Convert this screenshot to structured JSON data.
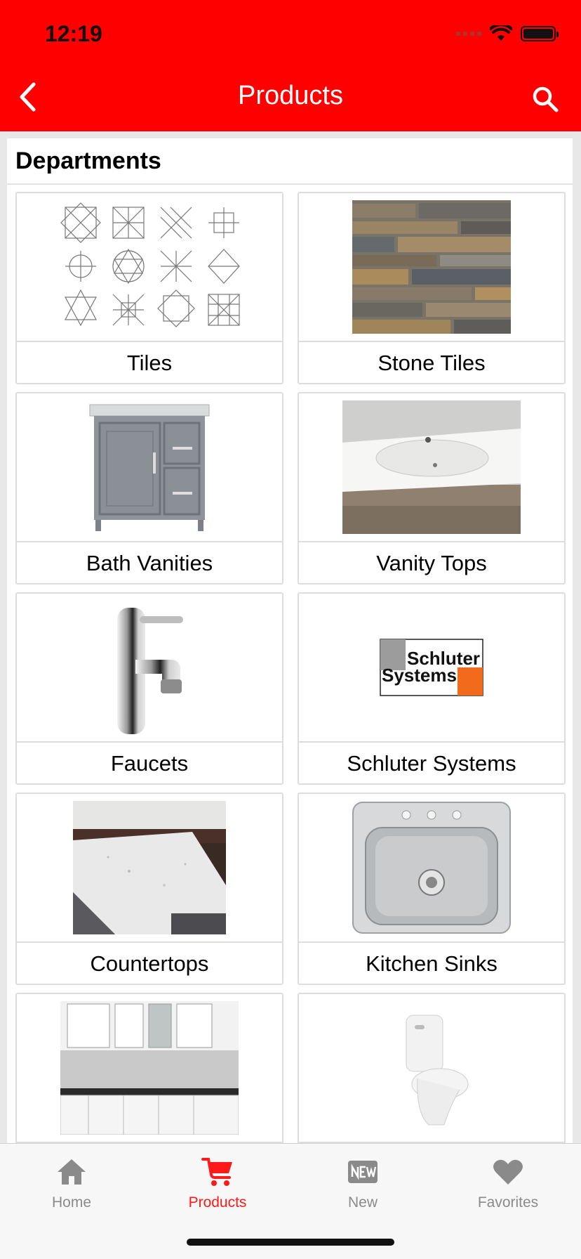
{
  "status": {
    "time": "12:19"
  },
  "nav": {
    "title": "Products"
  },
  "section": {
    "title": "Departments"
  },
  "departments": [
    {
      "label": "Tiles",
      "image": "tile-patterns"
    },
    {
      "label": "Stone Tiles",
      "image": "stone-ledger"
    },
    {
      "label": "Bath Vanities",
      "image": "gray-vanity"
    },
    {
      "label": "Vanity Tops",
      "image": "white-sink-top"
    },
    {
      "label": "Faucets",
      "image": "chrome-faucet"
    },
    {
      "label": "Schluter Systems",
      "image": "schluter-logo"
    },
    {
      "label": "Countertops",
      "image": "granite-counter"
    },
    {
      "label": "Kitchen Sinks",
      "image": "steel-sink"
    },
    {
      "label": "",
      "image": "white-kitchen-cabinets"
    },
    {
      "label": "",
      "image": "white-toilet"
    }
  ],
  "logo": {
    "line1": "Schluter",
    "line2": "Systems"
  },
  "tabs": [
    {
      "label": "Home",
      "icon": "home-icon",
      "active": false
    },
    {
      "label": "Products",
      "icon": "cart-icon",
      "active": true
    },
    {
      "label": "New",
      "icon": "new-badge-icon",
      "active": false
    },
    {
      "label": "Favorites",
      "icon": "heart-icon",
      "active": false
    }
  ],
  "colors": {
    "brand": "#ff0000",
    "tab_active": "#ff1a1a",
    "tab_inactive": "#8a8a8a"
  }
}
